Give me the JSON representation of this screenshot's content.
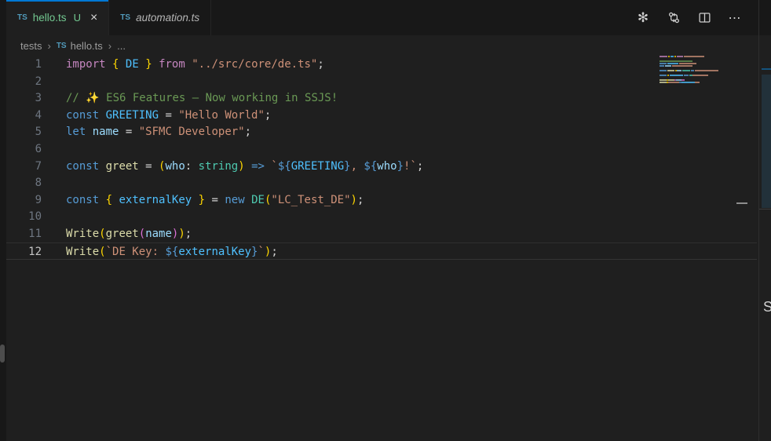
{
  "colors": {
    "accent_blue": "#0078d4",
    "editor_bg": "#1f1f1f",
    "tabstrip_bg": "#181818",
    "untracked_green": "#73C991",
    "ts_icon_blue": "#519aba"
  },
  "tab_bar": {
    "tabs": [
      {
        "icon": "TS",
        "label": "hello.ts",
        "badge": "U",
        "active": true,
        "label_color": "#73C991",
        "badge_color": "#73C991",
        "italic": false,
        "show_close": true,
        "close_glyph": "×"
      },
      {
        "icon": "TS",
        "label": "automation.ts",
        "badge": "",
        "active": false,
        "label_color": "#b5b5b5",
        "badge_color": "",
        "italic": true,
        "show_close": false,
        "close_glyph": ""
      }
    ],
    "actions": [
      {
        "name": "openai",
        "glyph": "✻"
      },
      {
        "name": "git-compare",
        "glyph": ""
      },
      {
        "name": "split-editor",
        "glyph": ""
      },
      {
        "name": "more-actions",
        "glyph": "⋯"
      }
    ]
  },
  "breadcrumb": {
    "chevron": "›",
    "items": [
      {
        "label": "tests",
        "icon": ""
      },
      {
        "label": "hello.ts",
        "icon": "TS"
      },
      {
        "label": "...",
        "icon": ""
      }
    ]
  },
  "editor": {
    "active_line": 12,
    "token_colors": {
      "kwc": "#C586C0",
      "kw": "#569CD6",
      "str": "#CE9178",
      "com": "#6A9955",
      "fn": "#DCDCAA",
      "var": "#9CDCFE",
      "cst": "#4FC1FF",
      "typ": "#4EC9B0",
      "pl": "#D4D4D4",
      "b1": "#FFD700",
      "b2": "#DA70D6",
      "tpl": "#569CD6",
      "emoji": "#e8c55a"
    },
    "lines": [
      {
        "n": 1,
        "tokens": [
          [
            "import",
            "kwc"
          ],
          [
            " ",
            "pl"
          ],
          [
            "{",
            "b1"
          ],
          [
            " ",
            "pl"
          ],
          [
            "DE",
            "cst"
          ],
          [
            " ",
            "pl"
          ],
          [
            "}",
            "b1"
          ],
          [
            " ",
            "pl"
          ],
          [
            "from",
            "kwc"
          ],
          [
            " ",
            "pl"
          ],
          [
            "\"../src/core/de.ts\"",
            "str"
          ],
          [
            ";",
            "pl"
          ]
        ]
      },
      {
        "n": 2,
        "tokens": []
      },
      {
        "n": 3,
        "tokens": [
          [
            "// ",
            "com"
          ],
          [
            "✨",
            "emoji"
          ],
          [
            " ES6 Features — Now working in SSJS!",
            "com"
          ]
        ]
      },
      {
        "n": 4,
        "tokens": [
          [
            "const",
            "kw"
          ],
          [
            " ",
            "pl"
          ],
          [
            "GREETING",
            "cst"
          ],
          [
            " = ",
            "pl"
          ],
          [
            "\"Hello World\"",
            "str"
          ],
          [
            ";",
            "pl"
          ]
        ]
      },
      {
        "n": 5,
        "tokens": [
          [
            "let",
            "kw"
          ],
          [
            " ",
            "pl"
          ],
          [
            "name",
            "var"
          ],
          [
            " = ",
            "pl"
          ],
          [
            "\"SFMC Developer\"",
            "str"
          ],
          [
            ";",
            "pl"
          ]
        ]
      },
      {
        "n": 6,
        "tokens": []
      },
      {
        "n": 7,
        "tokens": [
          [
            "const",
            "kw"
          ],
          [
            " ",
            "pl"
          ],
          [
            "greet",
            "fn"
          ],
          [
            " = ",
            "pl"
          ],
          [
            "(",
            "b1"
          ],
          [
            "who",
            "var"
          ],
          [
            ": ",
            "pl"
          ],
          [
            "string",
            "typ"
          ],
          [
            ")",
            "b1"
          ],
          [
            " ",
            "pl"
          ],
          [
            "=>",
            "kw"
          ],
          [
            " ",
            "pl"
          ],
          [
            "`",
            "str"
          ],
          [
            "${",
            "tpl"
          ],
          [
            "GREETING",
            "cst"
          ],
          [
            "}",
            "tpl"
          ],
          [
            ", ",
            "str"
          ],
          [
            "${",
            "tpl"
          ],
          [
            "who",
            "var"
          ],
          [
            "}",
            "tpl"
          ],
          [
            "!`",
            "str"
          ],
          [
            ";",
            "pl"
          ]
        ]
      },
      {
        "n": 8,
        "tokens": []
      },
      {
        "n": 9,
        "tokens": [
          [
            "const",
            "kw"
          ],
          [
            " ",
            "pl"
          ],
          [
            "{",
            "b1"
          ],
          [
            " ",
            "pl"
          ],
          [
            "externalKey",
            "cst"
          ],
          [
            " ",
            "pl"
          ],
          [
            "}",
            "b1"
          ],
          [
            " = ",
            "pl"
          ],
          [
            "new",
            "kw"
          ],
          [
            " ",
            "pl"
          ],
          [
            "DE",
            "typ"
          ],
          [
            "(",
            "b1"
          ],
          [
            "\"LC_Test_DE\"",
            "str"
          ],
          [
            ")",
            "b1"
          ],
          [
            ";",
            "pl"
          ]
        ]
      },
      {
        "n": 10,
        "tokens": []
      },
      {
        "n": 11,
        "tokens": [
          [
            "Write",
            "fn"
          ],
          [
            "(",
            "b1"
          ],
          [
            "greet",
            "fn"
          ],
          [
            "(",
            "b2"
          ],
          [
            "name",
            "var"
          ],
          [
            ")",
            "b2"
          ],
          [
            ")",
            "b1"
          ],
          [
            ";",
            "pl"
          ]
        ]
      },
      {
        "n": 12,
        "tokens": [
          [
            "Write",
            "fn"
          ],
          [
            "(",
            "b1"
          ],
          [
            "`DE Key: ",
            "str"
          ],
          [
            "${",
            "tpl"
          ],
          [
            "externalKey",
            "cst"
          ],
          [
            "}",
            "tpl"
          ],
          [
            "`",
            "str"
          ],
          [
            ")",
            "b1"
          ],
          [
            ";",
            "pl"
          ]
        ]
      }
    ]
  },
  "minimap": {
    "lines": [
      [
        [
          "kwc",
          10
        ],
        [
          "gap",
          1
        ],
        [
          "b1",
          2
        ],
        [
          "gap",
          1
        ],
        [
          "cst",
          4
        ],
        [
          "gap",
          1
        ],
        [
          "b1",
          2
        ],
        [
          "gap",
          1
        ],
        [
          "kwc",
          8
        ],
        [
          "gap",
          1
        ],
        [
          "str",
          26
        ]
      ],
      [],
      [
        [
          "com",
          42
        ]
      ],
      [
        [
          "kw",
          9
        ],
        [
          "gap",
          1
        ],
        [
          "cst",
          14
        ],
        [
          "gap",
          1
        ],
        [
          "str",
          22
        ]
      ],
      [
        [
          "kw",
          6
        ],
        [
          "gap",
          1
        ],
        [
          "var",
          8
        ],
        [
          "gap",
          1
        ],
        [
          "str",
          26
        ]
      ],
      [],
      [
        [
          "kw",
          9
        ],
        [
          "gap",
          1
        ],
        [
          "fn",
          9
        ],
        [
          "gap",
          1
        ],
        [
          "b1",
          2
        ],
        [
          "var",
          6
        ],
        [
          "gap",
          1
        ],
        [
          "typ",
          10
        ],
        [
          "gap",
          1
        ],
        [
          "kw",
          4
        ],
        [
          "gap",
          1
        ],
        [
          "str",
          30
        ]
      ],
      [],
      [
        [
          "kw",
          9
        ],
        [
          "gap",
          1
        ],
        [
          "b1",
          2
        ],
        [
          "gap",
          1
        ],
        [
          "cst",
          17
        ],
        [
          "gap",
          1
        ],
        [
          "kw",
          6
        ],
        [
          "gap",
          1
        ],
        [
          "typ",
          4
        ],
        [
          "str",
          20
        ]
      ],
      [],
      [
        [
          "fn",
          9
        ],
        [
          "b1",
          2
        ],
        [
          "fn",
          8
        ],
        [
          "b2",
          2
        ],
        [
          "var",
          7
        ],
        [
          "b2",
          4
        ]
      ],
      [
        [
          "fn",
          9
        ],
        [
          "b1",
          2
        ],
        [
          "str",
          14
        ],
        [
          "tpl",
          3
        ],
        [
          "cst",
          17
        ],
        [
          "str",
          6
        ]
      ]
    ]
  },
  "right_panel": {
    "partial_text": "S"
  }
}
